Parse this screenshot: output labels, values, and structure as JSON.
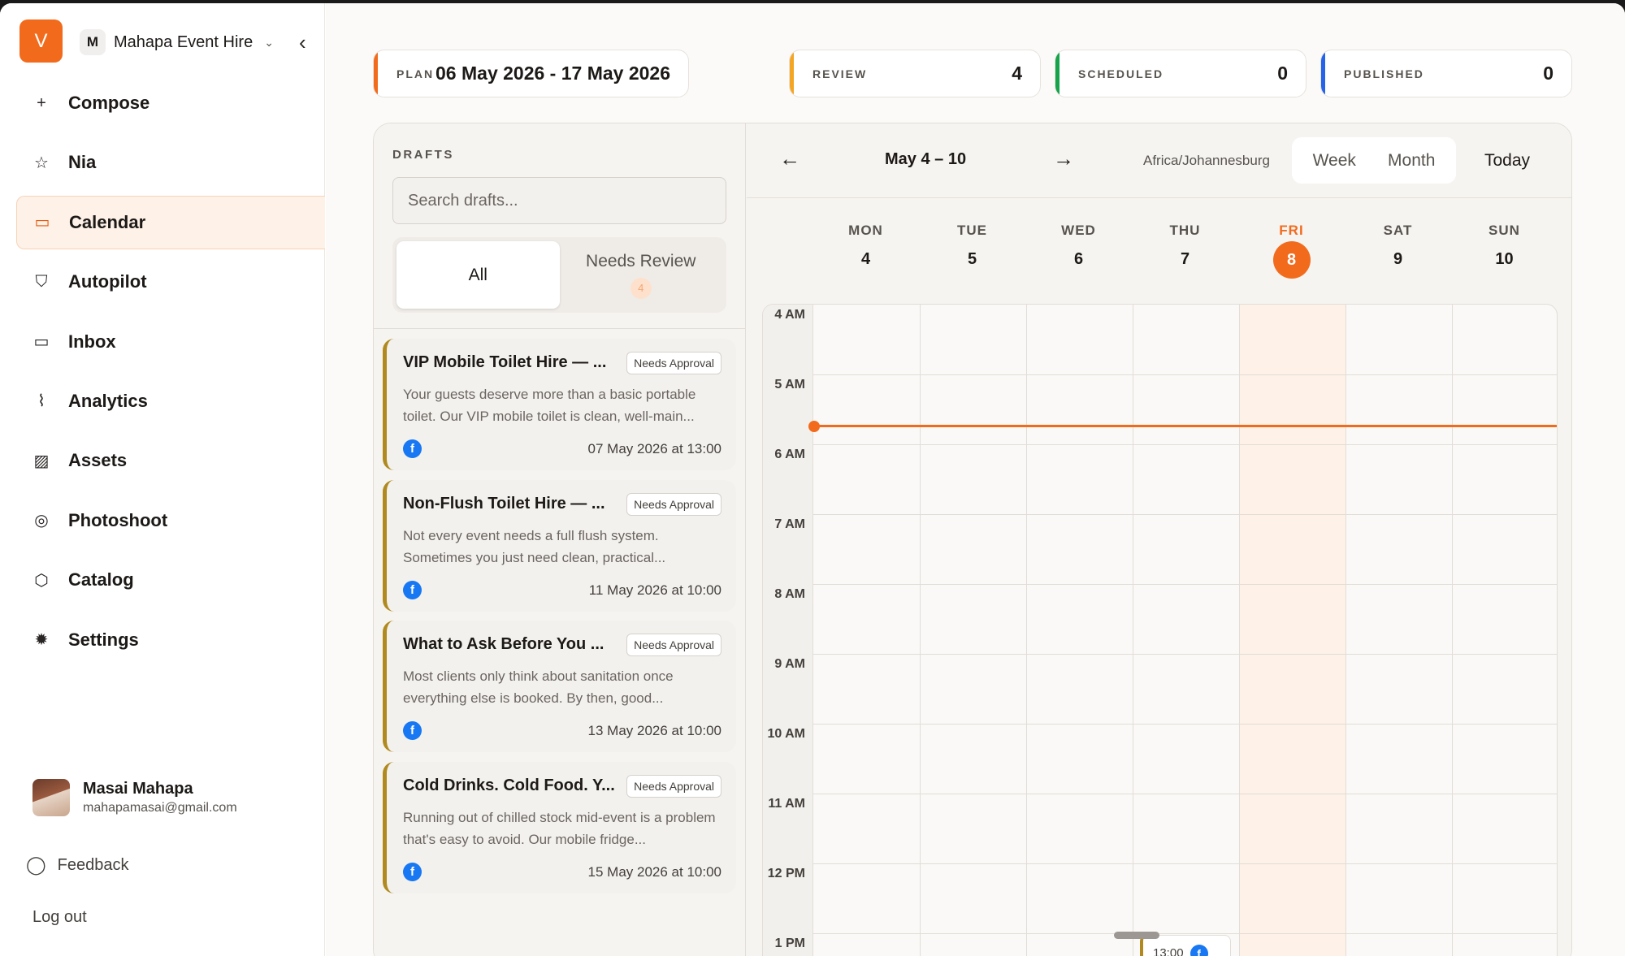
{
  "workspace": {
    "logo_letter": "V",
    "badge": "M",
    "name": "Mahapa Event Hire"
  },
  "nav": [
    {
      "label": "Compose",
      "icon": "plus-icon",
      "glyph": "+"
    },
    {
      "label": "Nia",
      "icon": "star-icon",
      "glyph": "☆"
    },
    {
      "label": "Calendar",
      "icon": "calendar-icon",
      "glyph": "▭",
      "active": true
    },
    {
      "label": "Autopilot",
      "icon": "shield-icon",
      "glyph": "⛉"
    },
    {
      "label": "Inbox",
      "icon": "inbox-icon",
      "glyph": "▭"
    },
    {
      "label": "Analytics",
      "icon": "trend-icon",
      "glyph": "⌇"
    },
    {
      "label": "Assets",
      "icon": "image-icon",
      "glyph": "▨"
    },
    {
      "label": "Photoshoot",
      "icon": "camera-icon",
      "glyph": "◎"
    },
    {
      "label": "Catalog",
      "icon": "box-icon",
      "glyph": "⬡"
    },
    {
      "label": "Settings",
      "icon": "gear-icon",
      "glyph": "✹"
    }
  ],
  "user": {
    "name": "Masai Mahapa",
    "email": "mahapamasai@gmail.com"
  },
  "footer": {
    "feedback": "Feedback",
    "logout": "Log out"
  },
  "stats": [
    {
      "key": "PLAN",
      "value": "06 May 2026 - 17 May 2026",
      "accent": "#f26b1d"
    },
    {
      "key": "REVIEW",
      "value": "4",
      "accent": "#f5a524"
    },
    {
      "key": "SCHEDULED",
      "value": "0",
      "accent": "#16a34a"
    },
    {
      "key": "PUBLISHED",
      "value": "0",
      "accent": "#2563eb"
    }
  ],
  "drafts": {
    "title": "DRAFTS",
    "search_placeholder": "Search drafts...",
    "tabs": {
      "all": "All",
      "review": "Needs Review",
      "review_count": "4"
    },
    "items": [
      {
        "title": "VIP Mobile Toilet Hire — ...",
        "badge": "Needs Approval",
        "body": "Your guests deserve more than a basic portable toilet. Our VIP mobile toilet is clean, well-main...",
        "date": "07 May 2026 at 13:00"
      },
      {
        "title": "Non-Flush Toilet Hire — ...",
        "badge": "Needs Approval",
        "body": "Not every event needs a full flush system. Sometimes you just need clean, practical...",
        "date": "11 May 2026 at 10:00"
      },
      {
        "title": "What to Ask Before You ...",
        "badge": "Needs Approval",
        "body": "Most clients only think about sanitation once everything else is booked. By then, good...",
        "date": "13 May 2026 at 10:00"
      },
      {
        "title": "Cold Drinks. Cold Food. Y...",
        "badge": "Needs Approval",
        "body": "Running out of chilled stock mid-event is a problem that's easy to avoid. Our mobile fridge...",
        "date": "15 May 2026 at 10:00"
      }
    ]
  },
  "calendar": {
    "prev": "←",
    "next": "→",
    "range": "May 4 – 10",
    "timezone": "Africa/Johannesburg",
    "views": {
      "week": "Week",
      "month": "Month"
    },
    "today": "Today",
    "days": [
      {
        "name": "MON",
        "date": "4"
      },
      {
        "name": "TUE",
        "date": "5"
      },
      {
        "name": "WED",
        "date": "6"
      },
      {
        "name": "THU",
        "date": "7"
      },
      {
        "name": "FRI",
        "date": "8",
        "today": true
      },
      {
        "name": "SAT",
        "date": "9"
      },
      {
        "name": "SUN",
        "date": "10"
      }
    ],
    "hours": [
      "4 AM",
      "5 AM",
      "6 AM",
      "7 AM",
      "8 AM",
      "9 AM",
      "10 AM",
      "11 AM",
      "12 PM",
      "1 PM"
    ],
    "event": {
      "time": "13:00",
      "day": "THU"
    }
  },
  "fb_glyph": "f",
  "fab_icon": "chat-bot-icon"
}
